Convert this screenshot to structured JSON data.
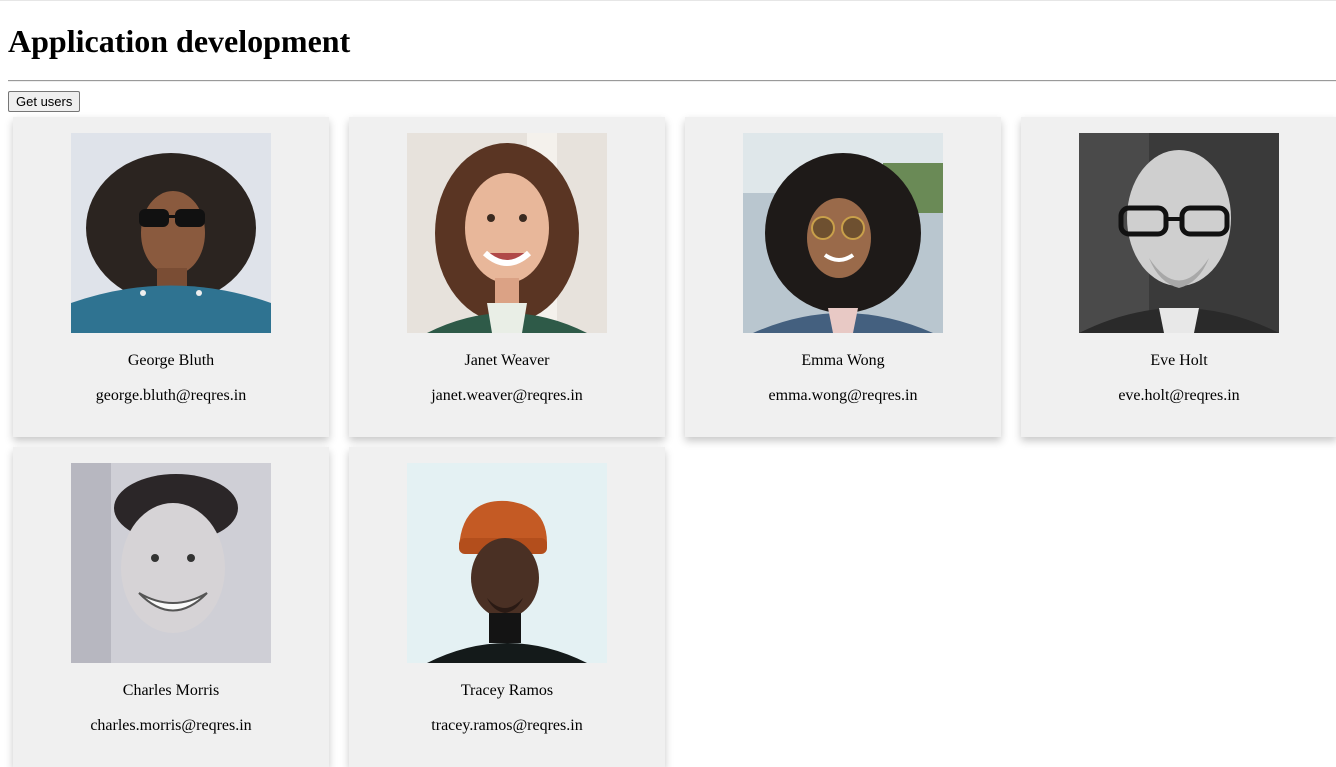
{
  "page": {
    "title": "Application development",
    "get_users_label": "Get users"
  },
  "users": [
    {
      "name": "George Bluth",
      "email": "george.bluth@reqres.in",
      "avatar": "avatar-george-icon"
    },
    {
      "name": "Janet Weaver",
      "email": "janet.weaver@reqres.in",
      "avatar": "avatar-janet-icon"
    },
    {
      "name": "Emma Wong",
      "email": "emma.wong@reqres.in",
      "avatar": "avatar-emma-icon"
    },
    {
      "name": "Eve Holt",
      "email": "eve.holt@reqres.in",
      "avatar": "avatar-eve-icon"
    },
    {
      "name": "Charles Morris",
      "email": "charles.morris@reqres.in",
      "avatar": "avatar-charles-icon"
    },
    {
      "name": "Tracey Ramos",
      "email": "tracey.ramos@reqres.in",
      "avatar": "avatar-tracey-icon"
    }
  ],
  "colors": {
    "card_background": "#f0f0f0",
    "page_background": "#ffffff"
  }
}
